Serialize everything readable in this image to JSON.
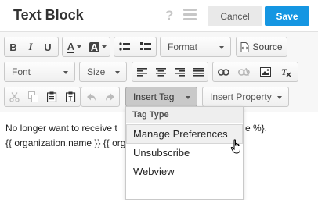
{
  "header": {
    "title": "Text Block",
    "help_icon": "?",
    "cancel_label": "Cancel",
    "save_label": "Save"
  },
  "toolbar": {
    "bold": "B",
    "italic": "I",
    "underline": "U",
    "text_color": "A",
    "bg_color": "A",
    "format_label": "Format",
    "source_label": "Source",
    "font_label": "Font",
    "size_label": "Size",
    "insert_tag_label": "Insert Tag",
    "insert_property_label": "Insert Property"
  },
  "editor": {
    "line1": "No longer want to receive t",
    "line1_right": "e %}.",
    "line2": "{{ organization.name }} {{ org"
  },
  "tag_menu": {
    "header": "Tag Type",
    "items": [
      {
        "label": "Manage Preferences"
      },
      {
        "label": "Unsubscribe"
      },
      {
        "label": "Webview"
      }
    ]
  },
  "colors": {
    "save": "#1596e2",
    "cancel": "#e9e9e9",
    "toolbar_bg": "#f7f7f7"
  }
}
